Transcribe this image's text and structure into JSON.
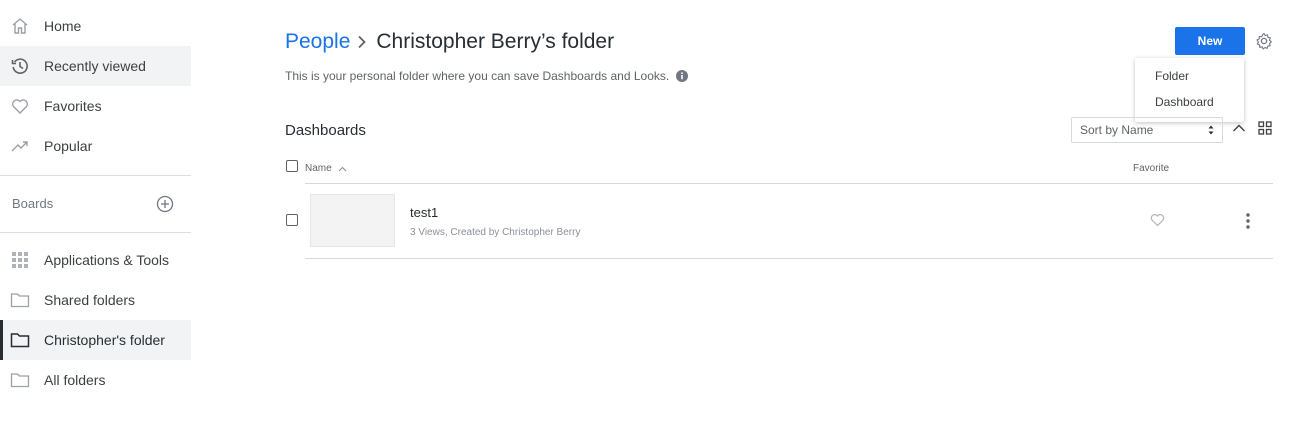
{
  "sidebar": {
    "items": [
      {
        "label": "Home",
        "icon": "home-icon"
      },
      {
        "label": "Recently viewed",
        "icon": "history-icon"
      },
      {
        "label": "Favorites",
        "icon": "heart-icon"
      },
      {
        "label": "Popular",
        "icon": "trending-icon"
      }
    ],
    "boards_title": "Boards",
    "folders": [
      {
        "label": "Applications & Tools",
        "icon": "grid-dots-icon"
      },
      {
        "label": "Shared folders",
        "icon": "folder-icon"
      },
      {
        "label": "Christopher's folder",
        "icon": "folder-icon"
      },
      {
        "label": "All folders",
        "icon": "folder-icon"
      }
    ]
  },
  "header": {
    "breadcrumb_parent": "People",
    "title": "Christopher Berry’s folder",
    "description": "This is your personal folder where you can save Dashboards and Looks.",
    "new_button": "New"
  },
  "new_menu": {
    "items": [
      "Folder",
      "Dashboard"
    ]
  },
  "dashboards": {
    "section_title": "Dashboards",
    "sort_label": "Sort by Name",
    "columns": {
      "name": "Name",
      "favorite": "Favorite"
    },
    "rows": [
      {
        "title": "test1",
        "meta": "3 Views, Created by Christopher Berry"
      }
    ]
  },
  "colors": {
    "accent": "#1a73e8",
    "active_bar": "#262d33",
    "active_bg": "#f2f3f4"
  }
}
